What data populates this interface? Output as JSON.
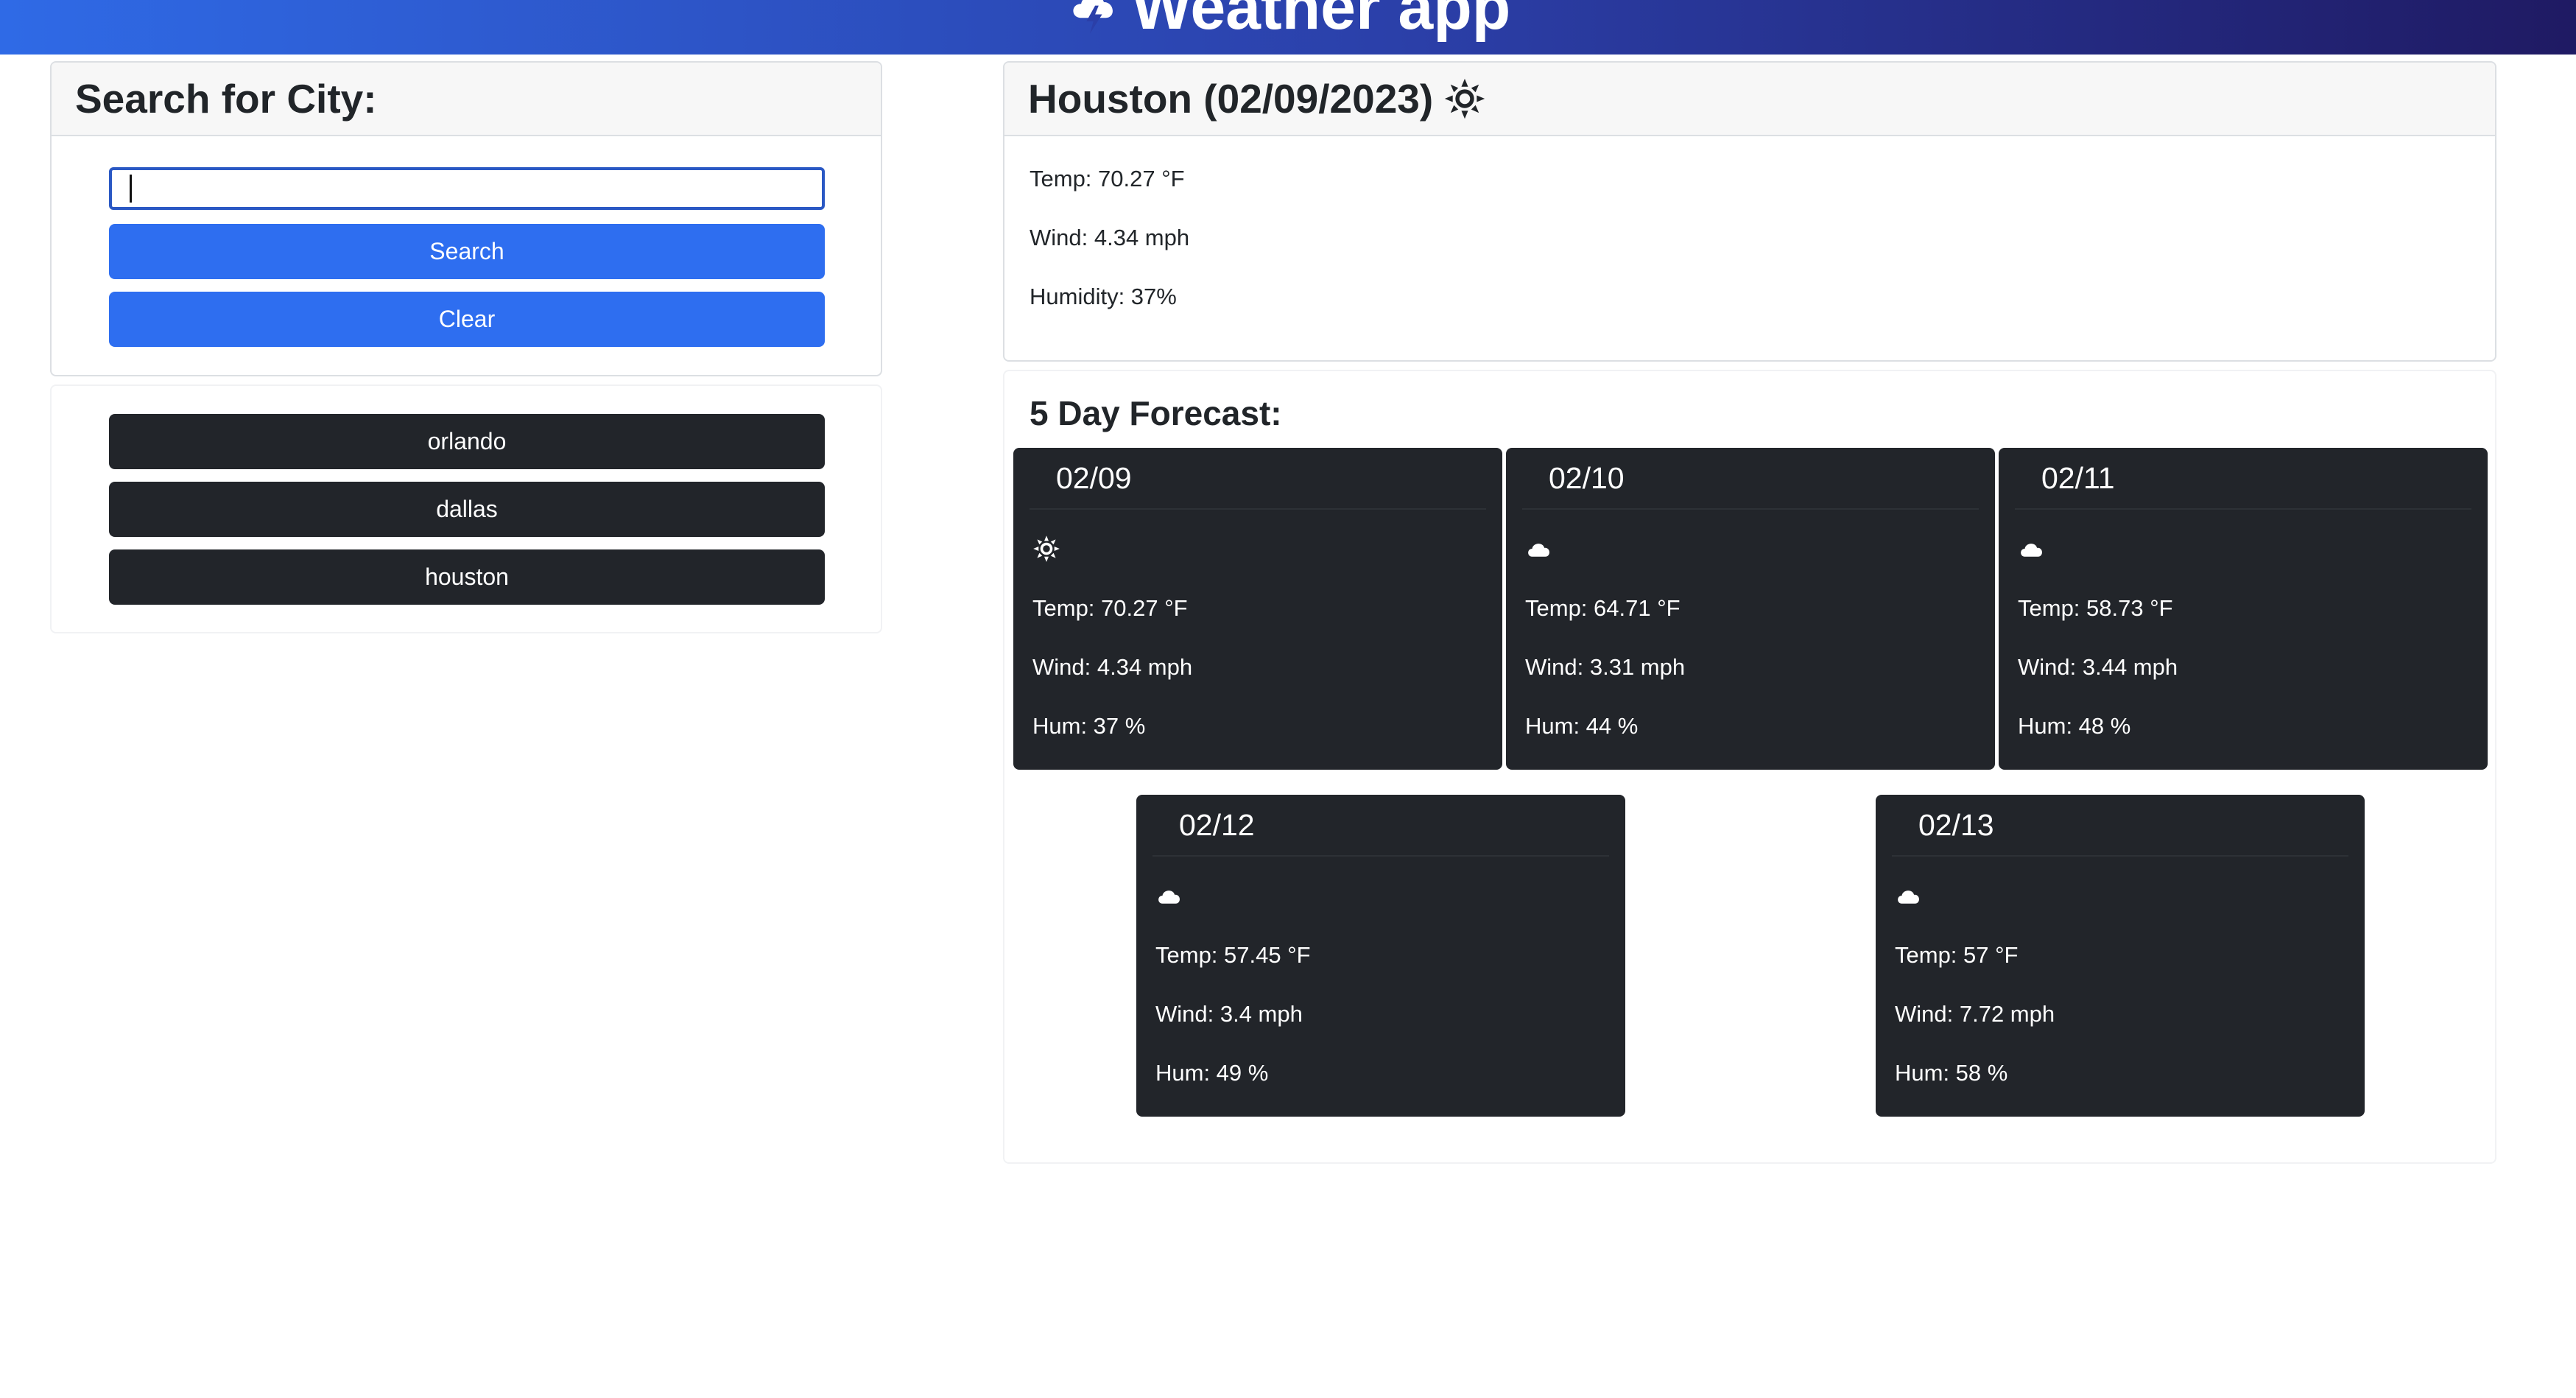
{
  "app": {
    "title": "Weather app",
    "header_icon": "lightning-cloud-icon",
    "header_gradient": [
      "#2f6ae6",
      "#2b3fa8",
      "#1f1a63"
    ]
  },
  "search": {
    "heading": "Search for City:",
    "input_value": "",
    "input_placeholder": "",
    "search_label": "Search",
    "clear_label": "Clear"
  },
  "history": {
    "items": [
      "orlando",
      "dallas",
      "houston"
    ]
  },
  "current": {
    "heading": "Houston (02/09/2023)",
    "icon": "sun-icon",
    "temp": "Temp: 70.27 °F",
    "wind": "Wind: 4.34 mph",
    "humidity": "Humidity: 37%"
  },
  "forecast": {
    "title": "5 Day Forecast:",
    "days": [
      {
        "date": "02/09",
        "icon": "sun-icon",
        "temp": "Temp: 70.27 °F",
        "wind": "Wind: 4.34 mph",
        "hum": "Hum: 37 %"
      },
      {
        "date": "02/10",
        "icon": "cloud-icon",
        "temp": "Temp: 64.71 °F",
        "wind": "Wind: 3.31 mph",
        "hum": "Hum: 44 %"
      },
      {
        "date": "02/11",
        "icon": "cloud-icon",
        "temp": "Temp: 58.73 °F",
        "wind": "Wind: 3.44 mph",
        "hum": "Hum: 48 %"
      },
      {
        "date": "02/12",
        "icon": "cloud-icon",
        "temp": "Temp: 57.45 °F",
        "wind": "Wind: 3.4 mph",
        "hum": "Hum: 49 %"
      },
      {
        "date": "02/13",
        "icon": "cloud-icon",
        "temp": "Temp: 57 °F",
        "wind": "Wind: 7.72 mph",
        "hum": "Hum: 58 %"
      }
    ]
  },
  "colors": {
    "primary_button": "#2e6ef0",
    "dark_card": "#22252a",
    "input_focus_border": "#2a58c4"
  }
}
